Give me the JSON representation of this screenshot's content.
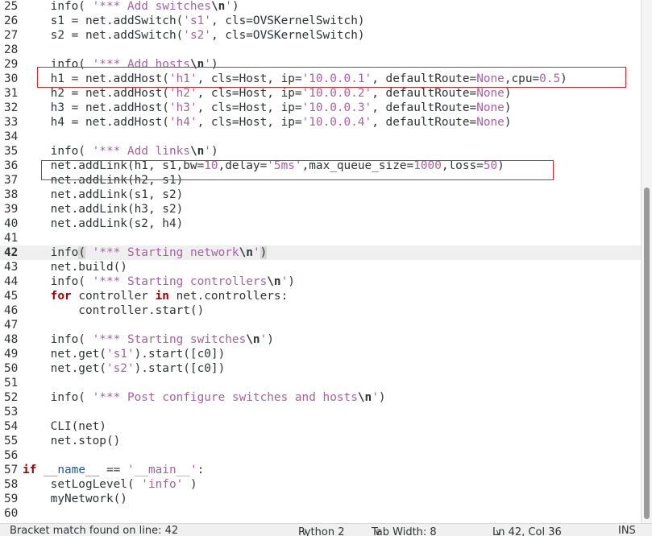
{
  "editor": {
    "current_line": 42,
    "lines": [
      {
        "n": "25",
        "segs": [
          [
            "",
            "    info( "
          ],
          [
            "str",
            "'*** Add switches"
          ],
          [
            "esc",
            "\\n"
          ],
          [
            "str",
            "'"
          ],
          [
            "",
            ")"
          ]
        ]
      },
      {
        "n": "26",
        "segs": [
          [
            "",
            "    s1 = net.addSwitch("
          ],
          [
            "str",
            "'s1'"
          ],
          [
            "",
            ", cls=OVSKernelSwitch)"
          ]
        ]
      },
      {
        "n": "27",
        "segs": [
          [
            "",
            "    s2 = net.addSwitch("
          ],
          [
            "str",
            "'s2'"
          ],
          [
            "",
            ", cls=OVSKernelSwitch)"
          ]
        ]
      },
      {
        "n": "28",
        "segs": []
      },
      {
        "n": "29",
        "segs": [
          [
            "",
            "    info( "
          ],
          [
            "str",
            "'*** Add hosts"
          ],
          [
            "esc",
            "\\n"
          ],
          [
            "str",
            "'"
          ],
          [
            "",
            ")"
          ]
        ]
      },
      {
        "n": "30",
        "segs": [
          [
            "",
            "    h1 = net.addHost("
          ],
          [
            "str",
            "'h1'"
          ],
          [
            "",
            ", cls=Host, ip="
          ],
          [
            "str",
            "'10.0.0.1'"
          ],
          [
            "",
            ", defaultRoute="
          ],
          [
            "none",
            "None"
          ],
          [
            "",
            ",cpu="
          ],
          [
            "num",
            "0.5"
          ],
          [
            "",
            ")"
          ]
        ]
      },
      {
        "n": "31",
        "segs": [
          [
            "",
            "    h2 = net.addHost("
          ],
          [
            "str",
            "'h2'"
          ],
          [
            "",
            ", cls=Host, ip="
          ],
          [
            "str",
            "'10.0.0.2'"
          ],
          [
            "",
            ", defaultRoute="
          ],
          [
            "none",
            "None"
          ],
          [
            "",
            ")"
          ]
        ]
      },
      {
        "n": "32",
        "segs": [
          [
            "",
            "    h3 = net.addHost("
          ],
          [
            "str",
            "'h3'"
          ],
          [
            "",
            ", cls=Host, ip="
          ],
          [
            "str",
            "'10.0.0.3'"
          ],
          [
            "",
            ", defaultRoute="
          ],
          [
            "none",
            "None"
          ],
          [
            "",
            ")"
          ]
        ]
      },
      {
        "n": "33",
        "segs": [
          [
            "",
            "    h4 = net.addHost("
          ],
          [
            "str",
            "'h4'"
          ],
          [
            "",
            ", cls=Host, ip="
          ],
          [
            "str",
            "'10.0.0.4'"
          ],
          [
            "",
            ", defaultRoute="
          ],
          [
            "none",
            "None"
          ],
          [
            "",
            ")"
          ]
        ]
      },
      {
        "n": "34",
        "segs": []
      },
      {
        "n": "35",
        "segs": [
          [
            "",
            "    info( "
          ],
          [
            "str",
            "'*** Add links"
          ],
          [
            "esc",
            "\\n"
          ],
          [
            "str",
            "'"
          ],
          [
            "",
            ")"
          ]
        ]
      },
      {
        "n": "36",
        "segs": [
          [
            "",
            "    net.addLink(h1, s1,bw="
          ],
          [
            "num",
            "10"
          ],
          [
            "",
            ",delay="
          ],
          [
            "str",
            "'5ms'"
          ],
          [
            "",
            ",max_queue_size="
          ],
          [
            "num",
            "1000"
          ],
          [
            "",
            ",loss="
          ],
          [
            "num",
            "50"
          ],
          [
            "",
            ")"
          ]
        ]
      },
      {
        "n": "37",
        "segs": [
          [
            "",
            "    net.addLink(h2, s1)"
          ]
        ]
      },
      {
        "n": "38",
        "segs": [
          [
            "",
            "    net.addLink(s1, s2)"
          ]
        ]
      },
      {
        "n": "39",
        "segs": [
          [
            "",
            "    net.addLink(h3, s2)"
          ]
        ]
      },
      {
        "n": "40",
        "segs": [
          [
            "",
            "    net.addLink(s2, h4)"
          ]
        ]
      },
      {
        "n": "41",
        "segs": []
      },
      {
        "n": "42",
        "segs": [
          [
            "",
            "    info"
          ],
          [
            "bm",
            "("
          ],
          [
            "",
            " "
          ],
          [
            "str",
            "'*** Starting network"
          ],
          [
            "esc",
            "\\n"
          ],
          [
            "str",
            "'"
          ],
          [
            "bm",
            ")"
          ]
        ]
      },
      {
        "n": "43",
        "segs": [
          [
            "",
            "    net.build()"
          ]
        ]
      },
      {
        "n": "44",
        "segs": [
          [
            "",
            "    info( "
          ],
          [
            "str",
            "'*** Starting controllers"
          ],
          [
            "esc",
            "\\n"
          ],
          [
            "str",
            "'"
          ],
          [
            "",
            ")"
          ]
        ]
      },
      {
        "n": "45",
        "segs": [
          [
            "",
            "    "
          ],
          [
            "kw",
            "for"
          ],
          [
            "",
            " controller "
          ],
          [
            "kw",
            "in"
          ],
          [
            "",
            " net.controllers:"
          ]
        ]
      },
      {
        "n": "46",
        "segs": [
          [
            "",
            "        controller.start()"
          ]
        ]
      },
      {
        "n": "47",
        "segs": []
      },
      {
        "n": "48",
        "segs": [
          [
            "",
            "    info( "
          ],
          [
            "str",
            "'*** Starting switches"
          ],
          [
            "esc",
            "\\n"
          ],
          [
            "str",
            "'"
          ],
          [
            "",
            ")"
          ]
        ]
      },
      {
        "n": "49",
        "segs": [
          [
            "",
            "    net.get("
          ],
          [
            "str",
            "'s1'"
          ],
          [
            "",
            ").start([c0])"
          ]
        ]
      },
      {
        "n": "50",
        "segs": [
          [
            "",
            "    net.get("
          ],
          [
            "str",
            "'s2'"
          ],
          [
            "",
            ").start([c0])"
          ]
        ]
      },
      {
        "n": "51",
        "segs": []
      },
      {
        "n": "52",
        "segs": [
          [
            "",
            "    info( "
          ],
          [
            "str",
            "'*** Post configure switches and hosts"
          ],
          [
            "esc",
            "\\n"
          ],
          [
            "str",
            "'"
          ],
          [
            "",
            ")"
          ]
        ]
      },
      {
        "n": "53",
        "segs": []
      },
      {
        "n": "54",
        "segs": [
          [
            "",
            "    CLI(net)"
          ]
        ]
      },
      {
        "n": "55",
        "segs": [
          [
            "",
            "    net.stop()"
          ]
        ]
      },
      {
        "n": "56",
        "segs": []
      },
      {
        "n": "57",
        "segs": [
          [
            "kw",
            "if"
          ],
          [
            "",
            " "
          ],
          [
            "sp",
            "__name__"
          ],
          [
            "",
            " == "
          ],
          [
            "str",
            "'__main__'"
          ],
          [
            "",
            ":"
          ]
        ]
      },
      {
        "n": "58",
        "segs": [
          [
            "",
            "    setLogLevel( "
          ],
          [
            "str",
            "'info'"
          ],
          [
            "",
            " )"
          ]
        ]
      },
      {
        "n": "59",
        "segs": [
          [
            "",
            "    myNetwork()"
          ]
        ]
      },
      {
        "n": "60",
        "segs": []
      }
    ]
  },
  "statusbar": {
    "message": "Bracket match found on line: 42",
    "language": "Python 2",
    "tab_width": "Tab Width: 8",
    "position": "Ln 42, Col 36",
    "mode": "INS"
  }
}
